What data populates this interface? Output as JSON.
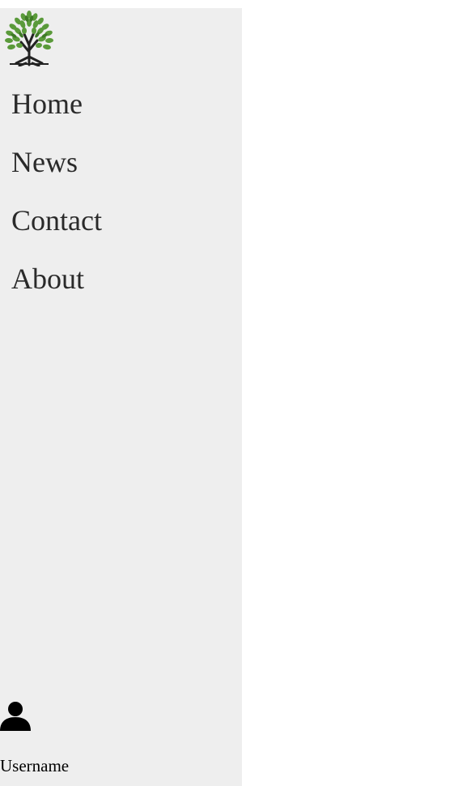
{
  "logo": {
    "icon": "tree-logo-icon",
    "leaf_color": "#5a9a3a",
    "trunk_color": "#222222"
  },
  "nav": {
    "items": [
      {
        "label": "Home"
      },
      {
        "label": "News"
      },
      {
        "label": "Contact"
      },
      {
        "label": "About"
      }
    ]
  },
  "user": {
    "icon": "user-icon",
    "name": "Username"
  },
  "colors": {
    "sidebar_bg": "#eeeeee",
    "nav_text": "#2a2a2a"
  }
}
